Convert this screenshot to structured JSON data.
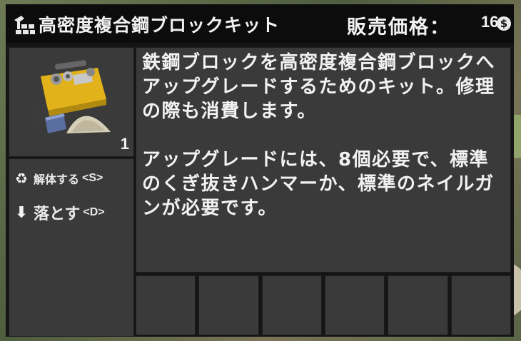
{
  "header": {
    "title": "高密度複合鋼ブロックキット",
    "price_label": "販売価格：",
    "price_value": "16",
    "currency_icon": "dukes-coin-icon",
    "currency_symbol": "$",
    "category_icon": "building-blocks-icon"
  },
  "item": {
    "icon": "toolbox-kit-icon",
    "count": "1"
  },
  "actions": [
    {
      "label": "解体する",
      "key": "<S>",
      "icon": "recycle-icon"
    },
    {
      "label": "落とす",
      "key": "<D>",
      "icon": "arrow-down-icon"
    }
  ],
  "description": {
    "p1": "鉄鋼ブロックを高密度複合鋼ブロックへアップグレードするためのキット。修理の際も消費します。",
    "p2": "アップグレードには、8個必要で、標準のくぎ抜きハンマーか、標準のネイルガンが必要です。"
  },
  "ingredient_slots": [
    {},
    {},
    {},
    {},
    {},
    {}
  ]
}
